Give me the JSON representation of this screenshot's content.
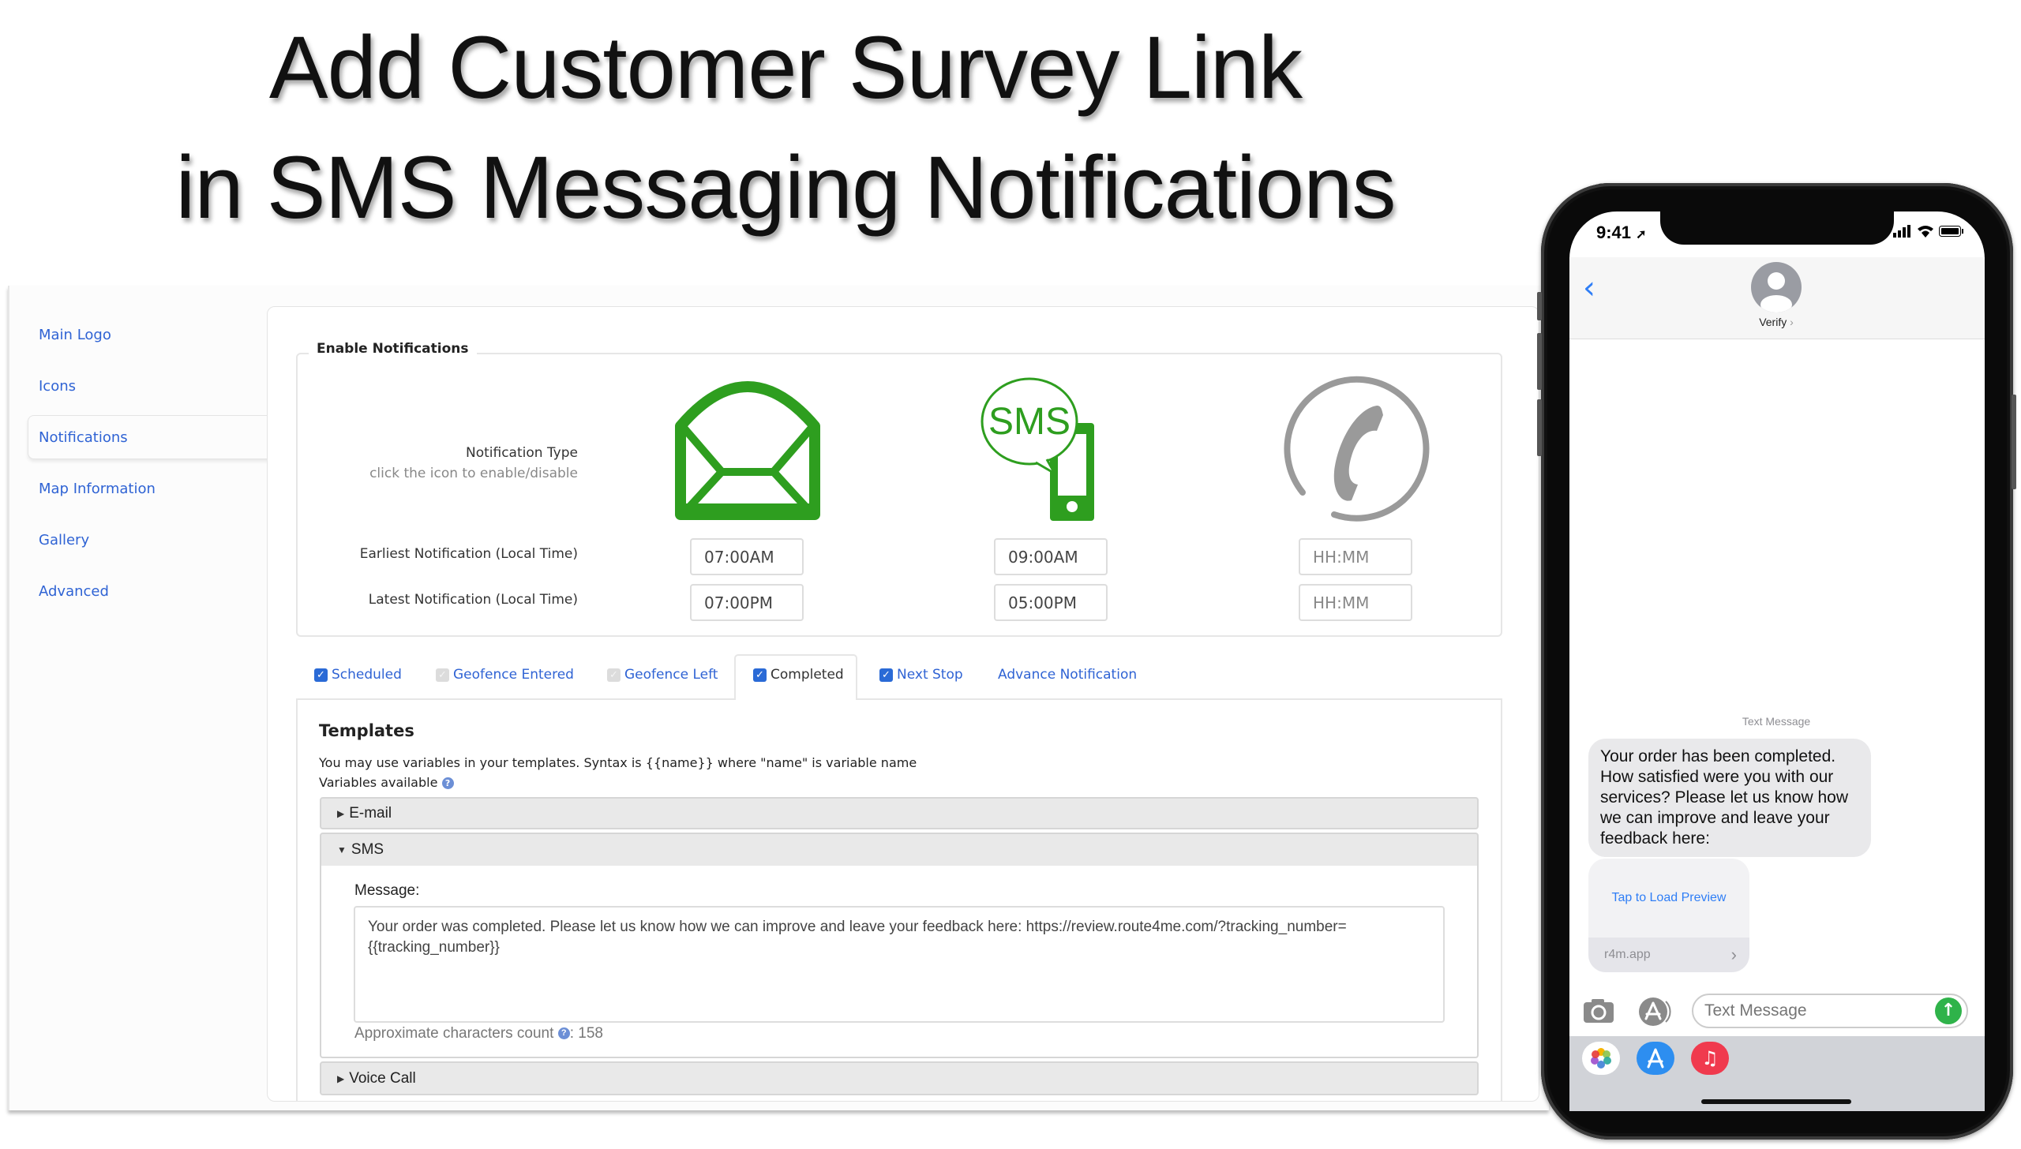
{
  "heading": {
    "line1": "Add Customer Survey Link",
    "line2": "in SMS Messaging Notifications"
  },
  "sidebar": {
    "items": [
      {
        "label": "Main Logo",
        "selected": false
      },
      {
        "label": "Icons",
        "selected": false
      },
      {
        "label": "Notifications",
        "selected": true
      },
      {
        "label": "Map Information",
        "selected": false
      },
      {
        "label": "Gallery",
        "selected": false
      },
      {
        "label": "Advanced",
        "selected": false
      }
    ]
  },
  "notifications": {
    "legend": "Enable Notifications",
    "type_label": "Notification Type",
    "type_hint": "click the icon to enable/disable",
    "earliest_label": "Earliest Notification (Local Time)",
    "latest_label": "Latest Notification (Local Time)",
    "channels": [
      {
        "name": "email",
        "icon": "envelope-icon",
        "enabled": true,
        "color": "#2e9e1f",
        "earliest": "07:00AM",
        "latest": "07:00PM",
        "placeholder": "HH:MM"
      },
      {
        "name": "sms",
        "icon": "sms-phone-icon",
        "enabled": true,
        "color": "#2e9e1f",
        "icon_text": "SMS",
        "earliest": "09:00AM",
        "latest": "05:00PM",
        "placeholder": "HH:MM"
      },
      {
        "name": "voice",
        "icon": "phone-handset-icon",
        "enabled": false,
        "color": "#9a9a9a",
        "earliest": "",
        "latest": "",
        "placeholder": "HH:MM"
      }
    ]
  },
  "tabs": [
    {
      "label": "Scheduled",
      "checked": true,
      "checkbox_enabled": true,
      "active": false
    },
    {
      "label": "Geofence Entered",
      "checked": true,
      "checkbox_enabled": false,
      "active": false
    },
    {
      "label": "Geofence Left",
      "checked": true,
      "checkbox_enabled": false,
      "active": false
    },
    {
      "label": "Completed",
      "checked": true,
      "checkbox_enabled": true,
      "active": true
    },
    {
      "label": "Next Stop",
      "checked": true,
      "checkbox_enabled": true,
      "active": false
    },
    {
      "label": "Advance Notification",
      "checked": null,
      "checkbox_enabled": false,
      "active": false
    }
  ],
  "templates": {
    "title": "Templates",
    "syntax_note": "You may use variables in your templates. Syntax is {{name}} where \"name\" is variable name",
    "variables_label": "Variables available",
    "help_glyph": "?",
    "sections": [
      {
        "label": "E-mail",
        "expanded": false
      },
      {
        "label": "SMS",
        "expanded": true
      },
      {
        "label": "Voice Call",
        "expanded": false
      }
    ],
    "sms": {
      "message_label": "Message:",
      "message_value": "Your order was completed. Please let us know how we can improve and leave your feedback here: https://review.route4me.com/?tracking_number={{tracking_number}}",
      "count_label": "Approximate characters count",
      "count_value": "158"
    }
  },
  "phone": {
    "status_time": "9:41",
    "contact_name": "Verify",
    "back_glyph": "‹",
    "message_meta": "Text Message",
    "message_text": "Your order has been completed. How satisfied were you with our services? Please let us know how we can improve and leave your feedback here:",
    "link_preview_label": "Tap to Load Preview",
    "link_domain": "r4m.app",
    "compose_placeholder": "Text Message",
    "send_glyph": "↑",
    "tray_apps": [
      "photos",
      "app-store",
      "music"
    ],
    "accent_color": "#2f7ef6",
    "send_color": "#2fb34a"
  },
  "colors": {
    "link_blue": "#2f63d4",
    "checkbox_blue": "#2a6ad6",
    "enabled_green": "#2e9e1f",
    "disabled_gray": "#9a9a9a"
  }
}
